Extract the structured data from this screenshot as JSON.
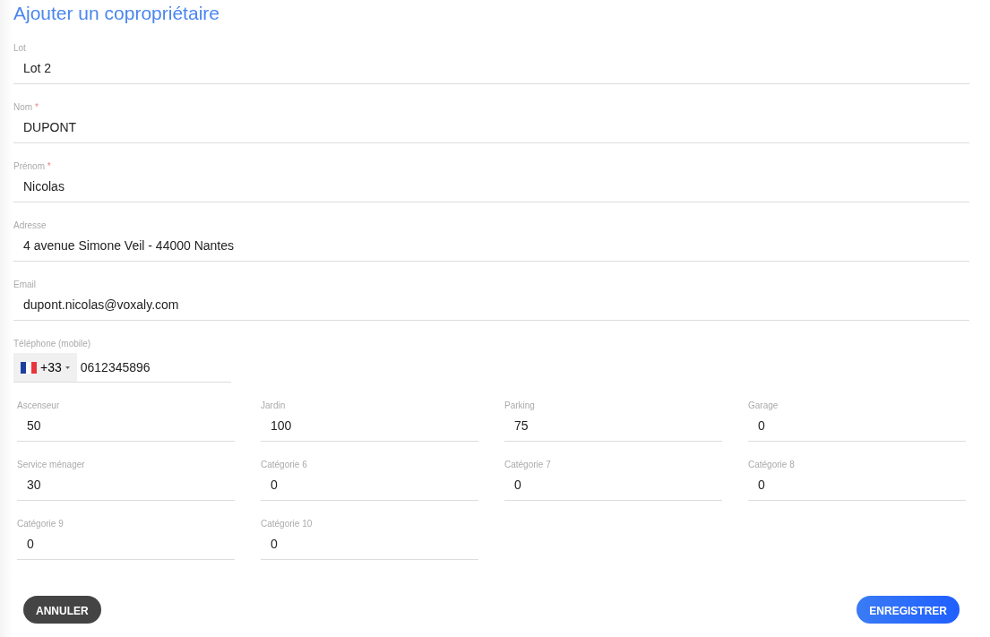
{
  "title": "Ajouter un copropriétaire",
  "fields": [
    {
      "label": "Lot",
      "value": "Lot 2"
    },
    {
      "label": "Nom",
      "value": "DUPONT",
      "required_mark": "*"
    },
    {
      "label": "Prénom",
      "value": "Nicolas",
      "required_mark": "*"
    },
    {
      "label": "Adresse",
      "value": "4 avenue Simone Veil - 44000 Nantes"
    },
    {
      "label": "Email",
      "value": "dupont.nicolas@voxaly.com"
    }
  ],
  "phone": {
    "label": "Téléphone (mobile)",
    "country_code": "+33",
    "value": "0612345896"
  },
  "categories": [
    {
      "label": "Ascenseur",
      "value": "50"
    },
    {
      "label": "Jardin",
      "value": "100"
    },
    {
      "label": "Parking",
      "value": "75"
    },
    {
      "label": "Garage",
      "value": "0"
    },
    {
      "label": "Service ménager",
      "value": "30"
    },
    {
      "label": "Catégorie 6",
      "value": "0"
    },
    {
      "label": "Catégorie 7",
      "value": "0"
    },
    {
      "label": "Catégorie 8",
      "value": "0"
    },
    {
      "label": "Catégorie 9",
      "value": "0"
    },
    {
      "label": "Catégorie 10",
      "value": "0"
    }
  ],
  "buttons": [
    {
      "label": "ANNULER",
      "kind": "secondary"
    },
    {
      "label": "ENREGISTRER",
      "kind": "primary"
    }
  ]
}
